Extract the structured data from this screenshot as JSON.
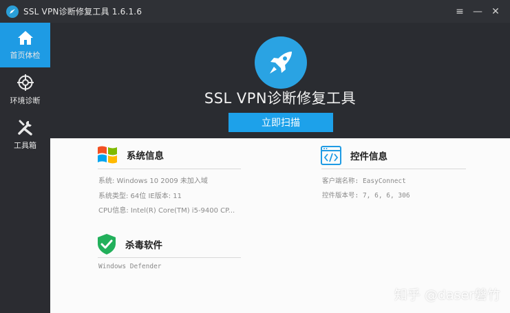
{
  "window": {
    "title": "SSL VPN诊断修复工具 1.6.1.6",
    "controls": {
      "menu": "≡",
      "minimize": "—",
      "close": "✕"
    }
  },
  "sidebar": {
    "items": [
      {
        "label": "首页体检",
        "icon": "home-icon",
        "active": true
      },
      {
        "label": "环境诊断",
        "icon": "crosshair-icon",
        "active": false
      },
      {
        "label": "工具箱",
        "icon": "tools-icon",
        "active": false
      }
    ]
  },
  "banner": {
    "title": "SSL VPN诊断修复工具",
    "scan_label": "立即扫描"
  },
  "system_info": {
    "title": "系统信息",
    "lines": [
      "系统: Windows 10 2009 未加入域",
      "系统类型: 64位  IE版本: 11",
      "CPU信息: Intel(R) Core(TM) i5-9400 CP..."
    ]
  },
  "control_info": {
    "title": "控件信息",
    "lines": [
      "客户端名称: EasyConnect",
      "控件版本号: 7, 6, 6, 306"
    ]
  },
  "antivirus": {
    "title": "杀毒软件",
    "lines": [
      "Windows Defender"
    ]
  },
  "watermark": "知乎 @daser磐竹",
  "colors": {
    "accent": "#1e9be4",
    "sidebar_bg": "#2b2c31",
    "content_bg": "#fbfbfb"
  }
}
